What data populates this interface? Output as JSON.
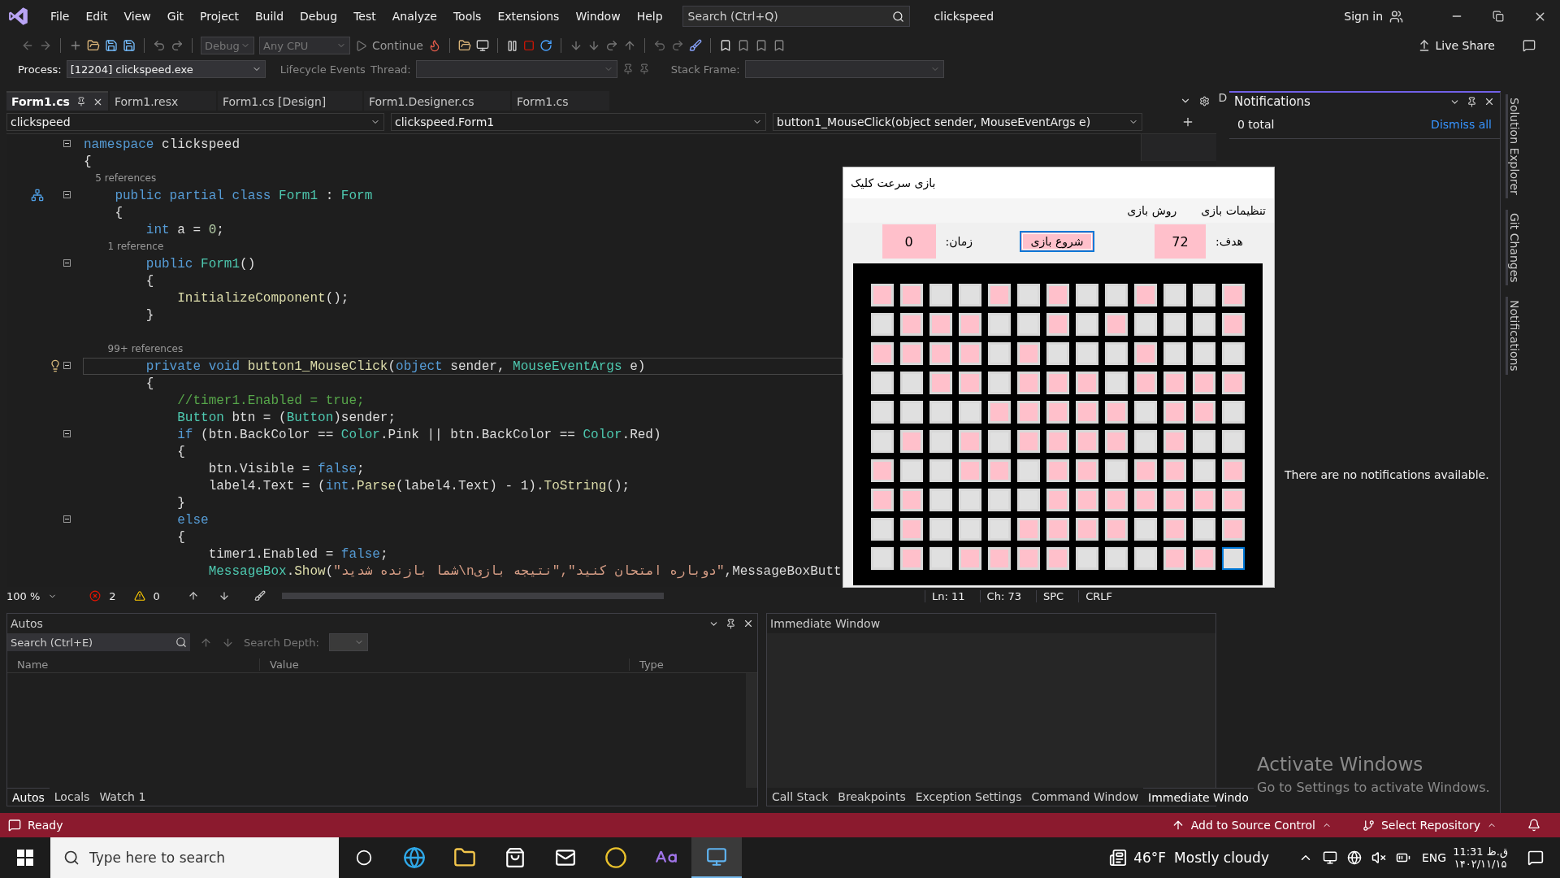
{
  "menu": {
    "items": [
      "File",
      "Edit",
      "View",
      "Git",
      "Project",
      "Build",
      "Debug",
      "Test",
      "Analyze",
      "Tools",
      "Extensions",
      "Window",
      "Help"
    ],
    "search_placeholder": "Search (Ctrl+Q)",
    "solution": "clickspeed",
    "sign_in": "Sign in"
  },
  "toolbar": {
    "configuration": "Debug",
    "platform": "Any CPU",
    "continue": "Continue",
    "live_share": "Live Share"
  },
  "debug_location": {
    "process_label": "Process:",
    "process": "[12204] clickspeed.exe",
    "lifecycle": "Lifecycle Events",
    "thread_label": "Thread:",
    "stack_frame_label": "Stack Frame:"
  },
  "doc_tabs": [
    {
      "label": "Form1.cs",
      "selected": true
    },
    {
      "label": "Form1.resx",
      "selected": false
    },
    {
      "label": "Form1.cs [Design]",
      "selected": false
    },
    {
      "label": "Form1.Designer.cs",
      "selected": false
    },
    {
      "label": "Form1.cs",
      "selected": false
    }
  ],
  "nav_bar": [
    "clickspeed",
    "clickspeed.Form1",
    "button1_MouseClick(object sender, MouseEventArgs e)"
  ],
  "code": [
    {
      "kind": "code",
      "fold": true,
      "current": false,
      "segments": [
        {
          "kind": "keyword",
          "text": "namespace"
        },
        {
          "kind": "plain",
          "text": " clickspeed"
        }
      ]
    },
    {
      "kind": "code",
      "fold": false,
      "current": false,
      "segments": [
        {
          "kind": "plain",
          "text": "{"
        }
      ]
    },
    {
      "kind": "lens",
      "text": "    5 references"
    },
    {
      "kind": "code",
      "fold": true,
      "current": false,
      "icon": {
        "kind": "hierarchy"
      },
      "segments": [
        {
          "kind": "keyword",
          "text": "    public partial class"
        },
        {
          "kind": "type",
          "text": " Form1"
        },
        {
          "kind": "plain",
          "text": " : "
        },
        {
          "kind": "type",
          "text": "Form"
        }
      ]
    },
    {
      "kind": "code",
      "fold": false,
      "current": false,
      "segments": [
        {
          "kind": "plain",
          "text": "    {"
        }
      ]
    },
    {
      "kind": "code",
      "fold": false,
      "current": false,
      "segments": [
        {
          "kind": "keyword",
          "text": "        int"
        },
        {
          "kind": "plain",
          "text": " a = "
        },
        {
          "kind": "number",
          "text": "0"
        },
        {
          "kind": "plain",
          "text": ";"
        }
      ]
    },
    {
      "kind": "lens",
      "text": "        1 reference"
    },
    {
      "kind": "code",
      "fold": true,
      "current": false,
      "segments": [
        {
          "kind": "keyword",
          "text": "        public"
        },
        {
          "kind": "type",
          "text": " Form1"
        },
        {
          "kind": "plain",
          "text": "()"
        }
      ]
    },
    {
      "kind": "code",
      "fold": false,
      "current": false,
      "segments": [
        {
          "kind": "plain",
          "text": "        {"
        }
      ]
    },
    {
      "kind": "code",
      "fold": false,
      "current": false,
      "segments": [
        {
          "kind": "method",
          "text": "            InitializeComponent"
        },
        {
          "kind": "plain",
          "text": "();"
        }
      ]
    },
    {
      "kind": "code",
      "fold": false,
      "current": false,
      "segments": [
        {
          "kind": "plain",
          "text": "        }"
        }
      ]
    },
    {
      "kind": "blank"
    },
    {
      "kind": "lens",
      "text": "        99+ references"
    },
    {
      "kind": "code",
      "fold": true,
      "current": true,
      "icon": {
        "kind": "lightbulb"
      },
      "segments": [
        {
          "kind": "keyword",
          "text": "        private void"
        },
        {
          "kind": "method",
          "text": " button1_MouseClick"
        },
        {
          "kind": "plain",
          "text": "("
        },
        {
          "kind": "keyword",
          "text": "object"
        },
        {
          "kind": "plain",
          "text": " sender, "
        },
        {
          "kind": "type",
          "text": "MouseEventArgs"
        },
        {
          "kind": "plain",
          "text": " e)"
        }
      ]
    },
    {
      "kind": "code",
      "fold": false,
      "current": false,
      "segments": [
        {
          "kind": "plain",
          "text": "        {"
        }
      ]
    },
    {
      "kind": "code",
      "fold": false,
      "current": false,
      "segments": [
        {
          "kind": "comment",
          "text": "            //timer1.Enabled = true;"
        }
      ]
    },
    {
      "kind": "code",
      "fold": false,
      "current": false,
      "segments": [
        {
          "kind": "type",
          "text": "            Button"
        },
        {
          "kind": "plain",
          "text": " btn = ("
        },
        {
          "kind": "type",
          "text": "Button"
        },
        {
          "kind": "plain",
          "text": ")sender;"
        }
      ]
    },
    {
      "kind": "code",
      "fold": true,
      "current": false,
      "segments": [
        {
          "kind": "keyword",
          "text": "            if"
        },
        {
          "kind": "plain",
          "text": " (btn.BackColor == "
        },
        {
          "kind": "type",
          "text": "Color"
        },
        {
          "kind": "plain",
          "text": ".Pink || btn.BackColor == "
        },
        {
          "kind": "type",
          "text": "Color"
        },
        {
          "kind": "plain",
          "text": ".Red)"
        }
      ]
    },
    {
      "kind": "code",
      "fold": false,
      "current": false,
      "segments": [
        {
          "kind": "plain",
          "text": "            {"
        }
      ]
    },
    {
      "kind": "code",
      "fold": false,
      "current": false,
      "segments": [
        {
          "kind": "plain",
          "text": "                btn.Visible = "
        },
        {
          "kind": "keyword",
          "text": "false"
        },
        {
          "kind": "plain",
          "text": ";"
        }
      ]
    },
    {
      "kind": "code",
      "fold": false,
      "current": false,
      "segments": [
        {
          "kind": "plain",
          "text": "                label4.Text = ("
        },
        {
          "kind": "keyword",
          "text": "int"
        },
        {
          "kind": "plain",
          "text": "."
        },
        {
          "kind": "method",
          "text": "Parse"
        },
        {
          "kind": "plain",
          "text": "(label4.Text) - 1)."
        },
        {
          "kind": "method",
          "text": "ToString"
        },
        {
          "kind": "plain",
          "text": "();"
        }
      ]
    },
    {
      "kind": "code",
      "fold": false,
      "current": false,
      "segments": [
        {
          "kind": "plain",
          "text": "            }"
        }
      ]
    },
    {
      "kind": "code",
      "fold": true,
      "current": false,
      "segments": [
        {
          "kind": "keyword",
          "text": "            else"
        }
      ]
    },
    {
      "kind": "code",
      "fold": false,
      "current": false,
      "segments": [
        {
          "kind": "plain",
          "text": "            {"
        }
      ]
    },
    {
      "kind": "code",
      "fold": false,
      "current": false,
      "segments": [
        {
          "kind": "plain",
          "text": "                timer1.Enabled = "
        },
        {
          "kind": "keyword",
          "text": "false"
        },
        {
          "kind": "plain",
          "text": ";"
        }
      ]
    },
    {
      "kind": "code",
      "fold": false,
      "current": false,
      "segments": [
        {
          "kind": "type",
          "text": "                MessageBox"
        },
        {
          "kind": "plain",
          "text": "."
        },
        {
          "kind": "method",
          "text": "Show"
        },
        {
          "kind": "plain",
          "text": "("
        },
        {
          "kind": "string",
          "text": "\"شما بازنده شدید\\nدوباره امتحان کنید\",\"نتیجه بازی\""
        },
        {
          "kind": "plain",
          "text": ",MessageBoxButt"
        }
      ]
    }
  ],
  "editor_status": {
    "zoom": "100 %",
    "errors": "2",
    "warnings": "0",
    "line": "Ln: 11",
    "column": "Ch: 73",
    "whitespace": "SPC",
    "line_ending": "CRLF"
  },
  "autos": {
    "title": "Autos",
    "search_placeholder": "Search (Ctrl+E)",
    "search_depth": "Search Depth:",
    "columns": [
      "Name",
      "Value",
      "Type"
    ],
    "tabs": [
      {
        "label": "Autos",
        "selected": true
      },
      {
        "label": "Locals",
        "selected": false
      },
      {
        "label": "Watch 1",
        "selected": false
      }
    ]
  },
  "immediate": {
    "title": "Immediate Window",
    "tabs": [
      {
        "label": "Call Stack",
        "selected": false
      },
      {
        "label": "Breakpoints",
        "selected": false
      },
      {
        "label": "Exception Settings",
        "selected": false
      },
      {
        "label": "Command Window",
        "selected": false
      },
      {
        "label": "Immediate Windo",
        "selected": true
      }
    ]
  },
  "notifications": {
    "strip_label": "D",
    "title": "Notifications",
    "count": "0 total",
    "dismiss": "Dismiss all",
    "empty": "There are no notifications available."
  },
  "side_tabs": [
    "Solution Explorer",
    "Git Changes",
    "Notifications"
  ],
  "form": {
    "title": "بازی سرعت کلیک",
    "menu": [
      "تنظیمات بازی",
      "روش بازی"
    ],
    "target_label": "هدف:",
    "target": "72",
    "start": "شروع بازی",
    "time_label": "زمان:",
    "time": "0",
    "cells": [
      [
        {
          "color": "#ffc0cb",
          "selected": false
        },
        {
          "color": "#ffc0cb",
          "selected": false
        },
        {
          "color": "#e0e0e0",
          "selected": false
        },
        {
          "color": "#e0e0e0",
          "selected": false
        },
        {
          "color": "#ffc0cb",
          "selected": false
        },
        {
          "color": "#e0e0e0",
          "selected": false
        },
        {
          "color": "#ffc0cb",
          "selected": false
        },
        {
          "color": "#e0e0e0",
          "selected": false
        },
        {
          "color": "#e0e0e0",
          "selected": false
        },
        {
          "color": "#ffc0cb",
          "selected": false
        },
        {
          "color": "#e0e0e0",
          "selected": false
        },
        {
          "color": "#e0e0e0",
          "selected": false
        },
        {
          "color": "#ffc0cb",
          "selected": false
        }
      ],
      [
        {
          "color": "#e0e0e0",
          "selected": false
        },
        {
          "color": "#ffc0cb",
          "selected": false
        },
        {
          "color": "#ffc0cb",
          "selected": false
        },
        {
          "color": "#ffc0cb",
          "selected": false
        },
        {
          "color": "#e0e0e0",
          "selected": false
        },
        {
          "color": "#e0e0e0",
          "selected": false
        },
        {
          "color": "#ffc0cb",
          "selected": false
        },
        {
          "color": "#e0e0e0",
          "selected": false
        },
        {
          "color": "#ffc0cb",
          "selected": false
        },
        {
          "color": "#e0e0e0",
          "selected": false
        },
        {
          "color": "#e0e0e0",
          "selected": false
        },
        {
          "color": "#e0e0e0",
          "selected": false
        },
        {
          "color": "#ffc0cb",
          "selected": false
        }
      ],
      [
        {
          "color": "#ffc0cb",
          "selected": false
        },
        {
          "color": "#ffc0cb",
          "selected": false
        },
        {
          "color": "#ffc0cb",
          "selected": false
        },
        {
          "color": "#ffc0cb",
          "selected": false
        },
        {
          "color": "#e0e0e0",
          "selected": false
        },
        {
          "color": "#ffc0cb",
          "selected": false
        },
        {
          "color": "#e0e0e0",
          "selected": false
        },
        {
          "color": "#e0e0e0",
          "selected": false
        },
        {
          "color": "#e0e0e0",
          "selected": false
        },
        {
          "color": "#ffc0cb",
          "selected": false
        },
        {
          "color": "#e0e0e0",
          "selected": false
        },
        {
          "color": "#e0e0e0",
          "selected": false
        },
        {
          "color": "#e0e0e0",
          "selected": false
        }
      ],
      [
        {
          "color": "#e0e0e0",
          "selected": false
        },
        {
          "color": "#e0e0e0",
          "selected": false
        },
        {
          "color": "#ffc0cb",
          "selected": false
        },
        {
          "color": "#ffc0cb",
          "selected": false
        },
        {
          "color": "#e0e0e0",
          "selected": false
        },
        {
          "color": "#ffc0cb",
          "selected": false
        },
        {
          "color": "#ffc0cb",
          "selected": false
        },
        {
          "color": "#ffc0cb",
          "selected": false
        },
        {
          "color": "#e0e0e0",
          "selected": false
        },
        {
          "color": "#ffc0cb",
          "selected": false
        },
        {
          "color": "#ffc0cb",
          "selected": false
        },
        {
          "color": "#ffc0cb",
          "selected": false
        },
        {
          "color": "#ffc0cb",
          "selected": false
        }
      ],
      [
        {
          "color": "#e0e0e0",
          "selected": false
        },
        {
          "color": "#e0e0e0",
          "selected": false
        },
        {
          "color": "#e0e0e0",
          "selected": false
        },
        {
          "color": "#e0e0e0",
          "selected": false
        },
        {
          "color": "#ffc0cb",
          "selected": false
        },
        {
          "color": "#ffc0cb",
          "selected": false
        },
        {
          "color": "#ffc0cb",
          "selected": false
        },
        {
          "color": "#ffc0cb",
          "selected": false
        },
        {
          "color": "#ffc0cb",
          "selected": false
        },
        {
          "color": "#e0e0e0",
          "selected": false
        },
        {
          "color": "#ffc0cb",
          "selected": false
        },
        {
          "color": "#ffc0cb",
          "selected": false
        },
        {
          "color": "#e0e0e0",
          "selected": false
        }
      ],
      [
        {
          "color": "#e0e0e0",
          "selected": false
        },
        {
          "color": "#ffc0cb",
          "selected": false
        },
        {
          "color": "#e0e0e0",
          "selected": false
        },
        {
          "color": "#ffc0cb",
          "selected": false
        },
        {
          "color": "#e0e0e0",
          "selected": false
        },
        {
          "color": "#ffc0cb",
          "selected": false
        },
        {
          "color": "#ffc0cb",
          "selected": false
        },
        {
          "color": "#ffc0cb",
          "selected": false
        },
        {
          "color": "#ffc0cb",
          "selected": false
        },
        {
          "color": "#e0e0e0",
          "selected": false
        },
        {
          "color": "#ffc0cb",
          "selected": false
        },
        {
          "color": "#e0e0e0",
          "selected": false
        },
        {
          "color": "#e0e0e0",
          "selected": false
        }
      ],
      [
        {
          "color": "#ffc0cb",
          "selected": false
        },
        {
          "color": "#e0e0e0",
          "selected": false
        },
        {
          "color": "#e0e0e0",
          "selected": false
        },
        {
          "color": "#ffc0cb",
          "selected": false
        },
        {
          "color": "#ffc0cb",
          "selected": false
        },
        {
          "color": "#e0e0e0",
          "selected": false
        },
        {
          "color": "#ffc0cb",
          "selected": false
        },
        {
          "color": "#ffc0cb",
          "selected": false
        },
        {
          "color": "#e0e0e0",
          "selected": false
        },
        {
          "color": "#ffc0cb",
          "selected": false
        },
        {
          "color": "#ffc0cb",
          "selected": false
        },
        {
          "color": "#e0e0e0",
          "selected": false
        },
        {
          "color": "#ffc0cb",
          "selected": false
        }
      ],
      [
        {
          "color": "#ffc0cb",
          "selected": false
        },
        {
          "color": "#ffc0cb",
          "selected": false
        },
        {
          "color": "#e0e0e0",
          "selected": false
        },
        {
          "color": "#e0e0e0",
          "selected": false
        },
        {
          "color": "#e0e0e0",
          "selected": false
        },
        {
          "color": "#e0e0e0",
          "selected": false
        },
        {
          "color": "#ffc0cb",
          "selected": false
        },
        {
          "color": "#ffc0cb",
          "selected": false
        },
        {
          "color": "#ffc0cb",
          "selected": false
        },
        {
          "color": "#ffc0cb",
          "selected": false
        },
        {
          "color": "#ffc0cb",
          "selected": false
        },
        {
          "color": "#ffc0cb",
          "selected": false
        },
        {
          "color": "#ffc0cb",
          "selected": false
        }
      ],
      [
        {
          "color": "#e0e0e0",
          "selected": false
        },
        {
          "color": "#ffc0cb",
          "selected": false
        },
        {
          "color": "#e0e0e0",
          "selected": false
        },
        {
          "color": "#e0e0e0",
          "selected": false
        },
        {
          "color": "#e0e0e0",
          "selected": false
        },
        {
          "color": "#ffc0cb",
          "selected": false
        },
        {
          "color": "#ffc0cb",
          "selected": false
        },
        {
          "color": "#ffc0cb",
          "selected": false
        },
        {
          "color": "#ffc0cb",
          "selected": false
        },
        {
          "color": "#e0e0e0",
          "selected": false
        },
        {
          "color": "#ffc0cb",
          "selected": false
        },
        {
          "color": "#e0e0e0",
          "selected": false
        },
        {
          "color": "#ffc0cb",
          "selected": false
        }
      ],
      [
        {
          "color": "#e0e0e0",
          "selected": false
        },
        {
          "color": "#ffc0cb",
          "selected": false
        },
        {
          "color": "#e0e0e0",
          "selected": false
        },
        {
          "color": "#ffc0cb",
          "selected": false
        },
        {
          "color": "#ffc0cb",
          "selected": false
        },
        {
          "color": "#ffc0cb",
          "selected": false
        },
        {
          "color": "#ffc0cb",
          "selected": false
        },
        {
          "color": "#e0e0e0",
          "selected": false
        },
        {
          "color": "#e0e0e0",
          "selected": false
        },
        {
          "color": "#e0e0e0",
          "selected": false
        },
        {
          "color": "#ffc0cb",
          "selected": false
        },
        {
          "color": "#ffc0cb",
          "selected": false
        },
        {
          "color": "#e0e0e0",
          "selected": true
        }
      ]
    ]
  },
  "status_bar": {
    "state": "Ready",
    "source_control": "Add to Source Control",
    "repository": "Select Repository"
  },
  "activation": {
    "title": "Activate Windows",
    "message": "Go to Settings to activate Windows."
  },
  "taskbar": {
    "search_placeholder": "Type here to search",
    "temperature": "46°F",
    "forecast": "Mostly cloudy",
    "language": "ENG",
    "time": "11:31 ق.ظ",
    "date": "۱۴۰۲/۱۱/۱۵"
  }
}
